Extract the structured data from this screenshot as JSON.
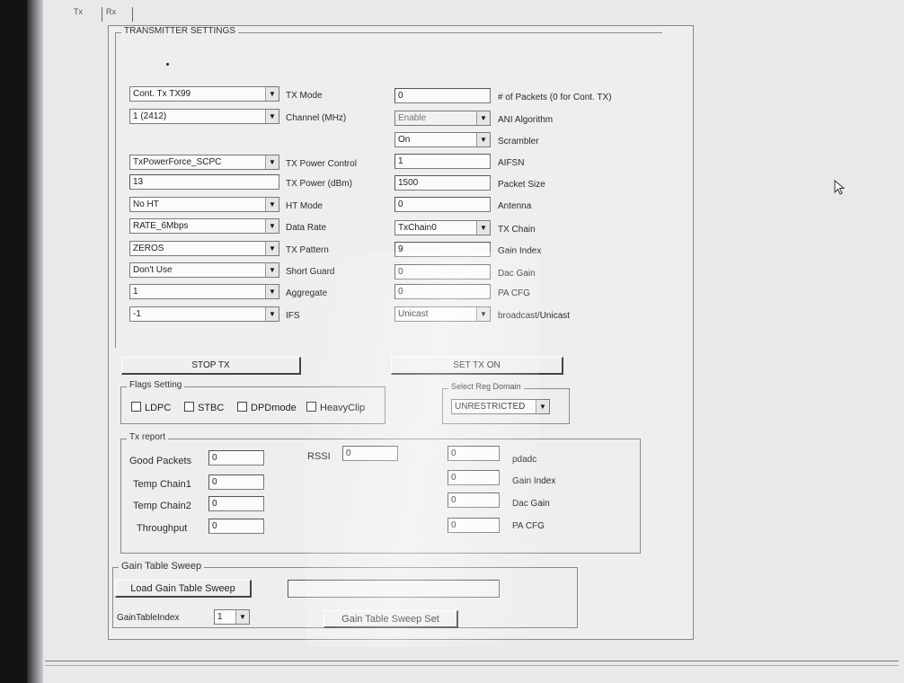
{
  "tabs": [
    "Tx",
    "Rx"
  ],
  "tx_settings": {
    "title": "TRANSMITTER SETTINGS",
    "left_rows": [
      {
        "kind": "combo",
        "value": "Cont. Tx TX99",
        "label": "TX Mode"
      },
      {
        "kind": "combo",
        "value": "1 (2412)",
        "label": "Channel (MHz)"
      },
      {
        "kind": "combo",
        "value": "TxPowerForce_SCPC",
        "label": "TX Power Control"
      },
      {
        "kind": "field",
        "value": "13",
        "label": "TX Power (dBm)"
      },
      {
        "kind": "combo",
        "value": "No HT",
        "label": "HT Mode"
      },
      {
        "kind": "combo",
        "value": "RATE_6Mbps",
        "label": "Data Rate"
      },
      {
        "kind": "combo",
        "value": "ZEROS",
        "label": "TX Pattern"
      },
      {
        "kind": "combo",
        "value": "Don't Use",
        "label": "Short Guard"
      },
      {
        "kind": "combo",
        "value": "1",
        "label": "Aggregate"
      },
      {
        "kind": "combo",
        "value": "-1",
        "label": "IFS"
      }
    ],
    "right_rows": [
      {
        "kind": "field",
        "value": "0",
        "label": "# of Packets (0 for Cont. TX)"
      },
      {
        "kind": "combo",
        "value": "Enable",
        "label": "ANI Algorithm",
        "disabled": true
      },
      {
        "kind": "combo",
        "value": "On",
        "label": "Scrambler"
      },
      {
        "kind": "field",
        "value": "1",
        "label": "AIFSN"
      },
      {
        "kind": "field",
        "value": "1500",
        "label": "Packet Size"
      },
      {
        "kind": "field",
        "value": "0",
        "label": "Antenna"
      },
      {
        "kind": "combo",
        "value": "TxChain0",
        "label": "TX Chain"
      },
      {
        "kind": "field",
        "value": "9",
        "label": "Gain Index"
      },
      {
        "kind": "field",
        "value": "0",
        "label": "Dac Gain"
      },
      {
        "kind": "field",
        "value": "0",
        "label": "PA CFG"
      },
      {
        "kind": "combo",
        "value": "Unicast",
        "label": "broadcast/Unicast"
      }
    ],
    "stop_tx_label": "STOP TX",
    "set_tx_on_label": "SET TX ON"
  },
  "flags": {
    "title": "Flags Setting",
    "items": [
      "LDPC",
      "STBC",
      "DPDmode",
      "HeavyClip"
    ]
  },
  "reg_domain": {
    "title": "Select Reg Domain",
    "value": "UNRESTRICTED"
  },
  "tx_report": {
    "title": "Tx report",
    "good_packets_label": "Good Packets",
    "good_packets": "0",
    "rssi_label": "RSSI",
    "rssi": "0",
    "temp_chain1_label": "Temp Chain1",
    "temp_chain1": "0",
    "temp_chain2_label": "Temp Chain2",
    "temp_chain2": "0",
    "throughput_label": "Throughput",
    "throughput": "0",
    "pdadc_label": "pdadc",
    "pdadc": "0",
    "gain_index_label": "Gain Index",
    "gain_index": "0",
    "dac_gain_label": "Dac Gain",
    "dac_gain": "0",
    "pa_cfg_label": "PA CFG",
    "pa_cfg": "0"
  },
  "gain_sweep": {
    "title": "Gain Table Sweep",
    "load_label": "Load Gain Table Sweep",
    "file_path": "",
    "index_label": "GainTableIndex",
    "index_value": "1",
    "set_label": "Gain Table Sweep Set"
  },
  "icons": {
    "dropdown": "dropdown-arrow-icon",
    "cursor": "mouse-pointer-icon"
  }
}
